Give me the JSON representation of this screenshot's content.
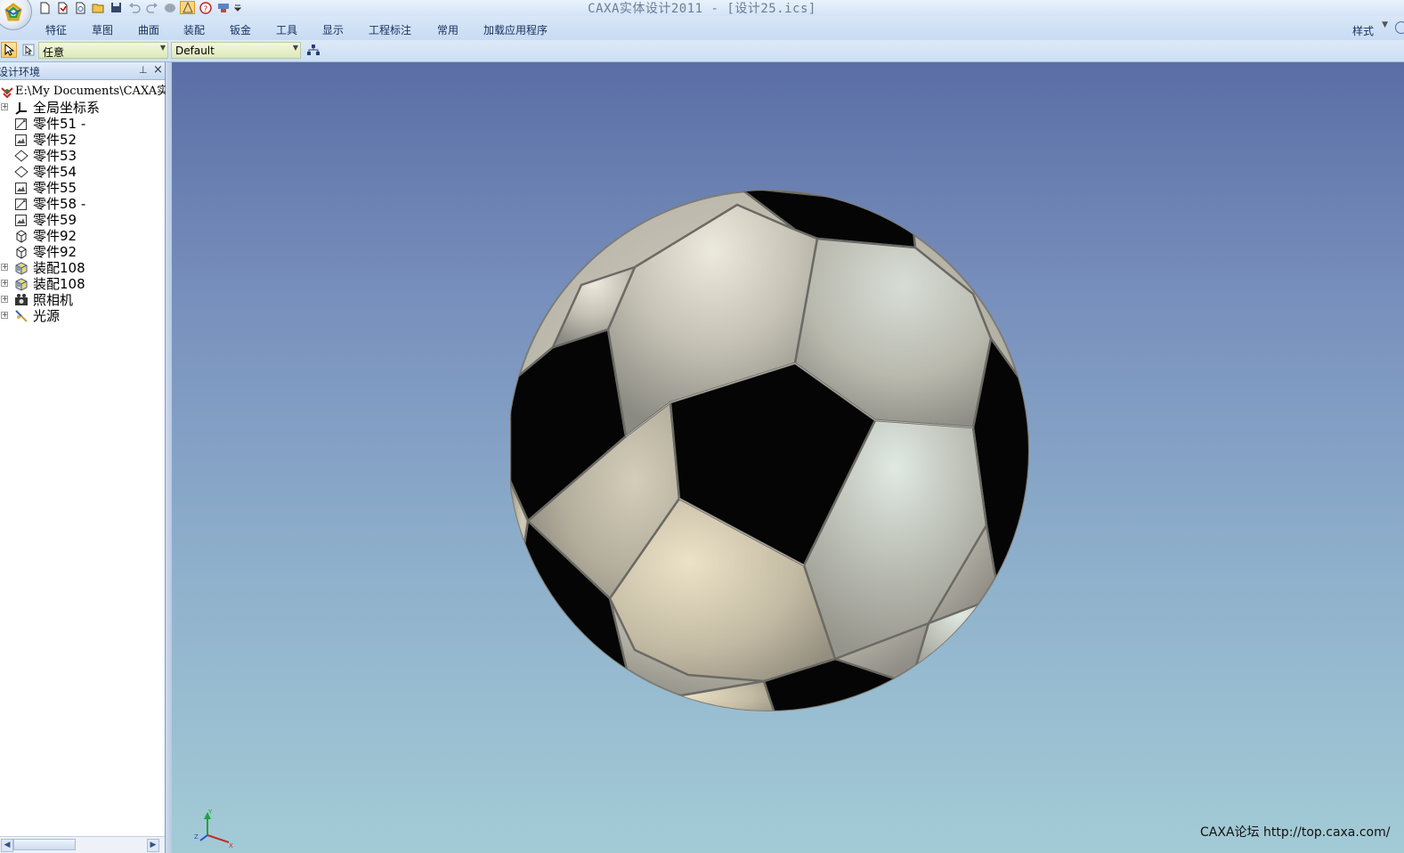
{
  "titlebar": {
    "app_title": "CAXA实体设计2011",
    "separator": " - ",
    "document": "[设计25.ics]"
  },
  "quick_access": [
    "new-icon",
    "open-folder-icon",
    "new-design-icon",
    "open-icon",
    "save-icon",
    "undo-icon",
    "redo-icon",
    "print-icon",
    "highlight-icon",
    "help-icon",
    "wizard-icon",
    "customize-arrow-icon"
  ],
  "ribbon": {
    "tabs": [
      "特征",
      "草图",
      "曲面",
      "装配",
      "钣金",
      "工具",
      "显示",
      "工程标注",
      "常用",
      "加载应用程序"
    ],
    "style_label": "样式"
  },
  "toolbar": {
    "filter_value": "任意",
    "config_value": "Default"
  },
  "panel": {
    "title": "设计环境",
    "tree": [
      {
        "label": "E:\\My Documents\\CAXA实",
        "icon": "design-root-icon",
        "expand": false,
        "root": true
      },
      {
        "label": "全局坐标系",
        "icon": "coordinate-system-icon",
        "expand": true
      },
      {
        "label": "零件51 -",
        "icon": "part-sketch-icon",
        "expand": false
      },
      {
        "label": "零件52",
        "icon": "part-image-icon",
        "expand": false
      },
      {
        "label": "零件53",
        "icon": "part-surface-icon",
        "expand": false
      },
      {
        "label": "零件54",
        "icon": "part-surface-icon",
        "expand": false
      },
      {
        "label": "零件55",
        "icon": "part-image-icon",
        "expand": false
      },
      {
        "label": "零件58 -",
        "icon": "part-sketch-icon",
        "expand": false
      },
      {
        "label": "零件59",
        "icon": "part-image-icon",
        "expand": false
      },
      {
        "label": "零件92",
        "icon": "part-solid-icon",
        "expand": false
      },
      {
        "label": "零件92",
        "icon": "part-solid-icon",
        "expand": false
      },
      {
        "label": "装配108",
        "icon": "assembly-icon",
        "expand": true
      },
      {
        "label": "装配108",
        "icon": "assembly-icon",
        "expand": true
      },
      {
        "label": "照相机",
        "icon": "camera-icon",
        "expand": true
      },
      {
        "label": "光源",
        "icon": "light-source-icon",
        "expand": true
      }
    ]
  },
  "viewport": {
    "model": "soccer-ball",
    "triad_labels": {
      "x": "X",
      "y": "Y",
      "z": "Z"
    },
    "watermark": "CAXA论坛 http://top.caxa.com/"
  },
  "colors": {
    "viewport_top": "#5a6ea5",
    "viewport_bottom": "#a3cbd6",
    "panel_patch": "#c4c2b8",
    "black_patch": "#050505"
  }
}
